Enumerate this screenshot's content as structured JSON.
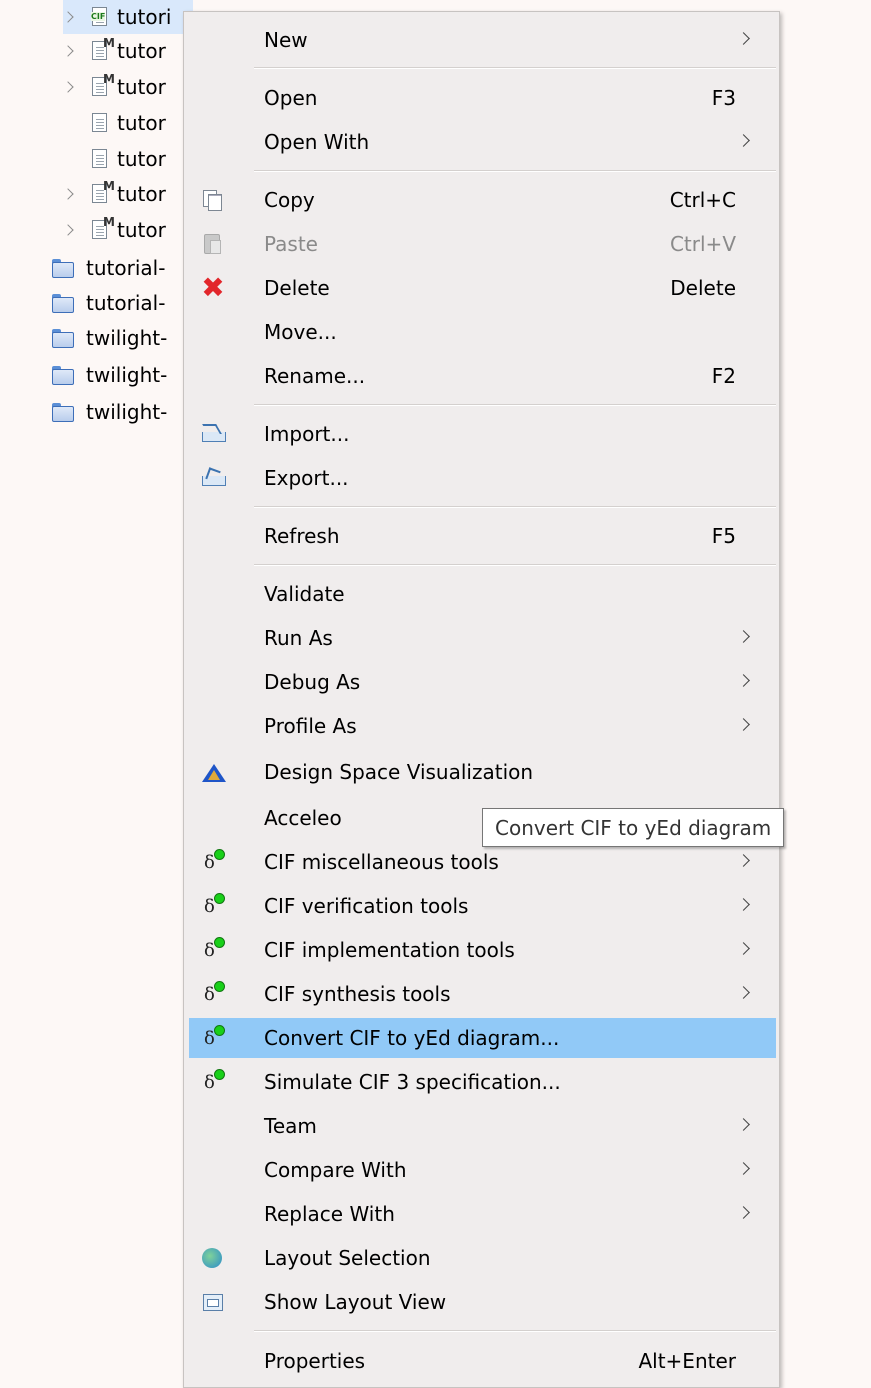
{
  "tree": {
    "rows": [
      {
        "label": "tutori",
        "icon": "cif-file-icon",
        "expandable": true,
        "selected": true
      },
      {
        "label": "tutor",
        "icon": "model-file-icon",
        "expandable": true
      },
      {
        "label": "tutor",
        "icon": "model-file-icon",
        "expandable": true
      },
      {
        "label": "tutor",
        "icon": "text-file-icon",
        "expandable": false
      },
      {
        "label": "tutor",
        "icon": "text-file-icon",
        "expandable": false
      },
      {
        "label": "tutor",
        "icon": "model-file-icon",
        "expandable": true
      },
      {
        "label": "tutor",
        "icon": "model-file-icon",
        "expandable": true
      },
      {
        "label": "tutorial-",
        "icon": "folder-icon"
      },
      {
        "label": "tutorial-",
        "icon": "folder-icon"
      },
      {
        "label": "twilight-",
        "icon": "folder-icon"
      },
      {
        "label": "twilight-",
        "icon": "folder-icon"
      },
      {
        "label": "twilight-",
        "icon": "folder-icon"
      }
    ]
  },
  "menu": {
    "new": "New",
    "open": "Open",
    "open_sc": "F3",
    "open_with": "Open With",
    "copy": "Copy",
    "copy_sc": "Ctrl+C",
    "paste": "Paste",
    "paste_sc": "Ctrl+V",
    "delete": "Delete",
    "delete_sc": "Delete",
    "move": "Move...",
    "rename": "Rename...",
    "rename_sc": "F2",
    "import": "Import...",
    "export": "Export...",
    "refresh": "Refresh",
    "refresh_sc": "F5",
    "validate": "Validate",
    "run_as": "Run As",
    "debug_as": "Debug As",
    "profile_as": "Profile As",
    "dsv": "Design Space Visualization",
    "acceleo": "Acceleo",
    "cif_misc": "CIF miscellaneous tools",
    "cif_verif": "CIF verification tools",
    "cif_impl": "CIF implementation tools",
    "cif_synth": "CIF synthesis tools",
    "convert_yed": "Convert CIF to yEd diagram...",
    "simulate": "Simulate CIF 3 specification...",
    "team": "Team",
    "compare_with": "Compare With",
    "replace_with": "Replace With",
    "layout_selection": "Layout Selection",
    "show_layout_view": "Show Layout View",
    "properties": "Properties",
    "properties_sc": "Alt+Enter"
  },
  "tooltip": "Convert CIF to yEd diagram",
  "colors": {
    "highlight": "#91c9f7",
    "menu_bg": "#f0eded",
    "cif_dot": "#19d019",
    "delete_red": "#e2262b"
  }
}
